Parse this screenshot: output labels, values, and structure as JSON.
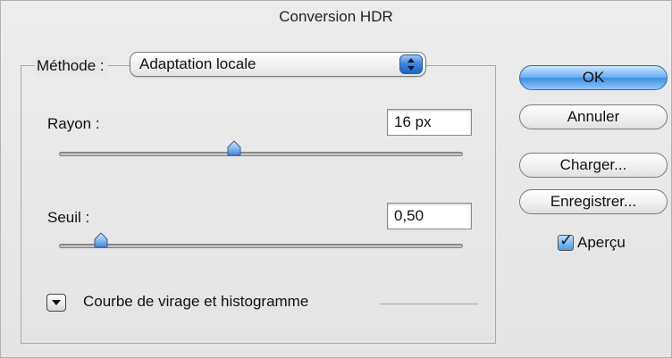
{
  "dialog": {
    "title": "Conversion HDR"
  },
  "method": {
    "label": "Méthode :",
    "value": "Adaptation locale"
  },
  "radius": {
    "label": "Rayon :",
    "value": "16 px"
  },
  "threshold": {
    "label": "Seuil :",
    "value": "0,50"
  },
  "toning_curve": {
    "label": "Courbe de virage et histogramme"
  },
  "buttons": {
    "ok": "OK",
    "cancel": "Annuler",
    "load": "Charger...",
    "save": "Enregistrer..."
  },
  "preview": {
    "label": "Aperçu",
    "checked": true
  },
  "colors": {
    "accent": "#4a9be8",
    "panel": "#e8e8e8"
  }
}
